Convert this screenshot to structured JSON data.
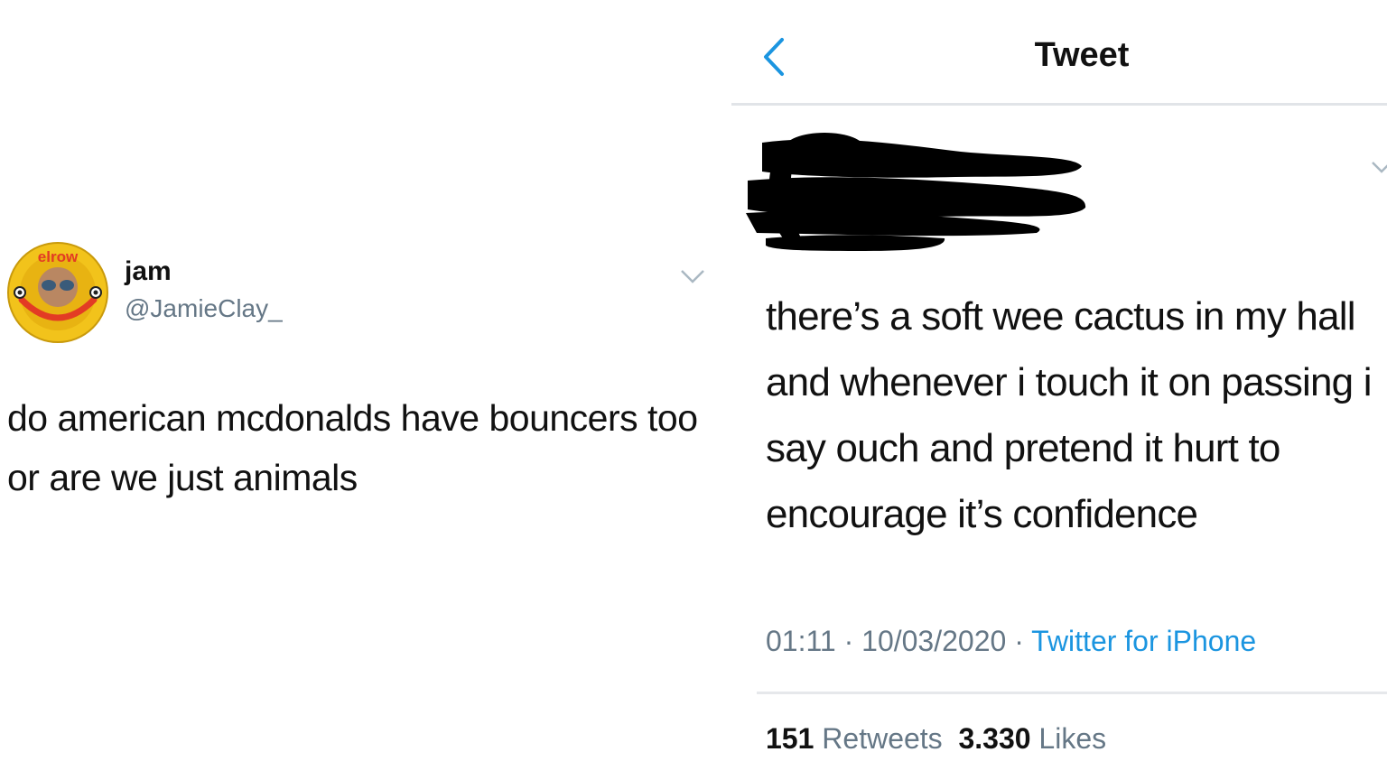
{
  "left_tweet": {
    "avatar_text": "elrow",
    "author_name": "jam",
    "author_handle": "@JamieClay_",
    "text": "do american mcdonalds have bouncers too or are we just animals"
  },
  "right_tweet": {
    "header_title": "Tweet",
    "text": "there’s a soft wee cactus in my hall and whenever i touch it on passing i say ouch and pretend it hurt to encourage it’s confidence",
    "time": "01:11",
    "date": "10/03/2020",
    "separator": "·",
    "source": "Twitter for iPhone",
    "retweets_count": "151",
    "retweets_label": "Retweets",
    "likes_count": "3.330",
    "likes_label": "Likes",
    "colors": {
      "link": "#1b95e0",
      "secondary_text": "#657786"
    }
  },
  "icons": [
    "back-arrow-icon",
    "chevron-down-icon"
  ]
}
